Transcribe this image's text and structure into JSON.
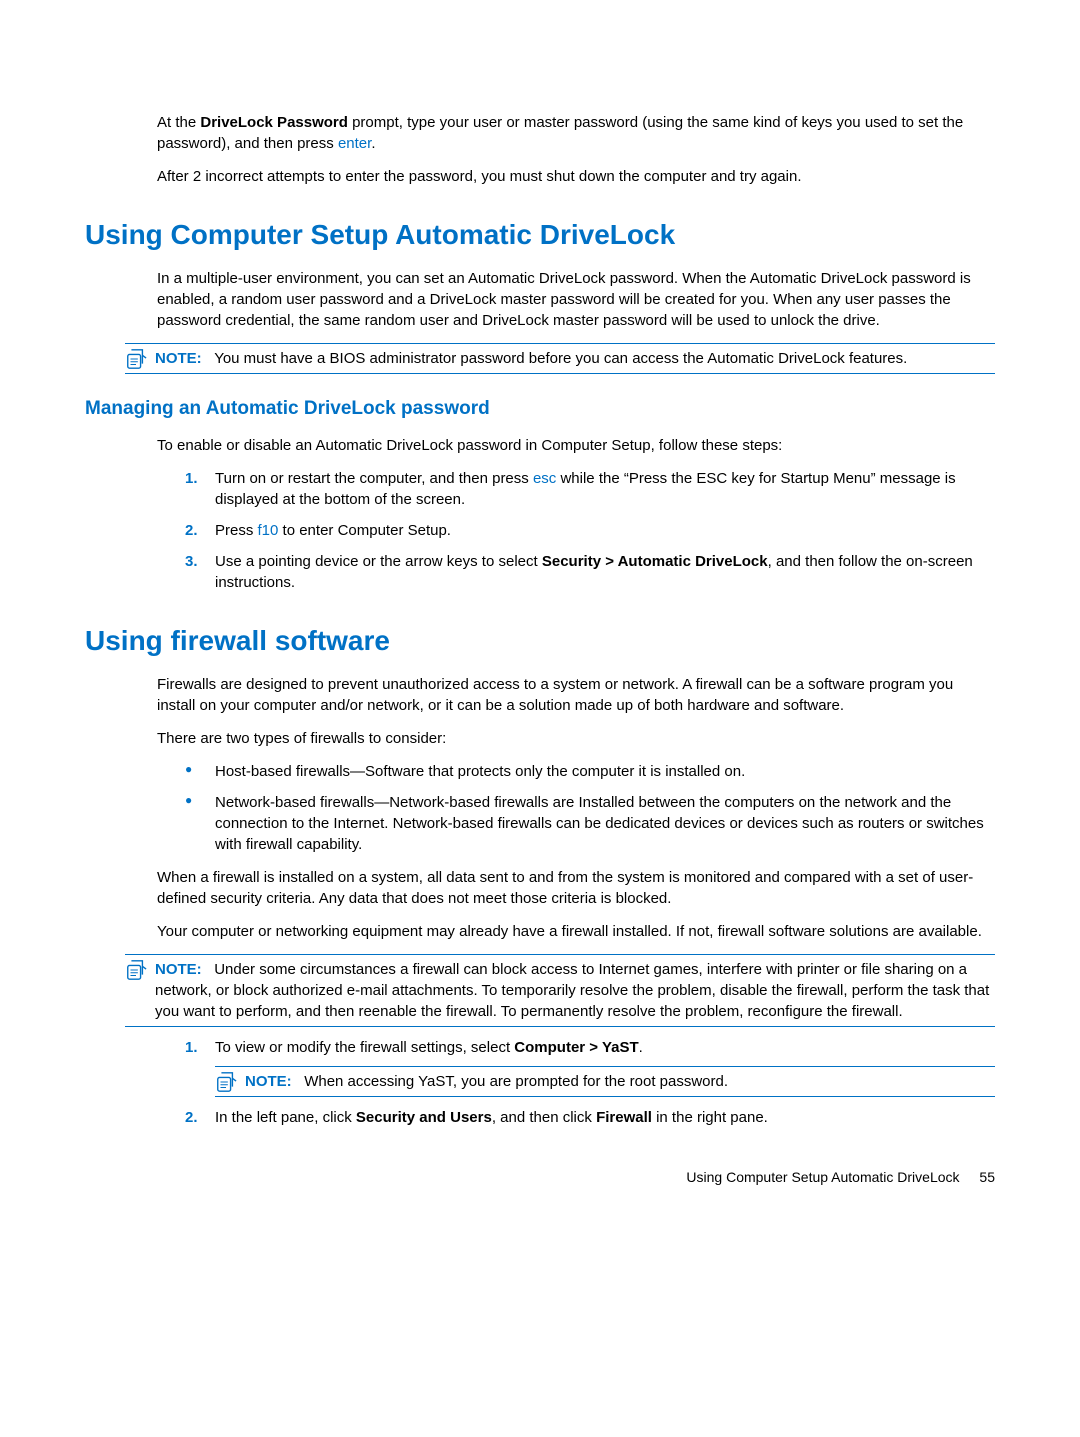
{
  "intro": {
    "p1_a": "At the ",
    "p1_b": "DriveLock Password",
    "p1_c": " prompt, type your user or master password (using the same kind of keys you used to set the password), and then press ",
    "p1_key": "enter",
    "p1_d": ".",
    "p2": "After 2 incorrect attempts to enter the password, you must shut down the computer and try again."
  },
  "sec1": {
    "title": "Using Computer Setup Automatic DriveLock",
    "p1": "In a multiple-user environment, you can set an Automatic DriveLock password. When the Automatic DriveLock password is enabled, a random user password and a DriveLock master password will be created for you. When any user passes the password credential, the same random user and DriveLock master password will be used to unlock the drive.",
    "note_label": "NOTE:",
    "note_text": "You must have a BIOS administrator password before you can access the Automatic DriveLock features.",
    "sub_title": "Managing an Automatic DriveLock password",
    "sub_p1": "To enable or disable an Automatic DriveLock password in Computer Setup, follow these steps:",
    "step1_n": "1.",
    "step1_a": "Turn on or restart the computer, and then press ",
    "step1_key": "esc",
    "step1_b": " while the “Press the ESC key for Startup Menu” message is displayed at the bottom of the screen.",
    "step2_n": "2.",
    "step2_a": "Press ",
    "step2_key": "f10",
    "step2_b": " to enter Computer Setup.",
    "step3_n": "3.",
    "step3_a": "Use a pointing device or the arrow keys to select ",
    "step3_b": "Security > Automatic DriveLock",
    "step3_c": ", and then follow the on-screen instructions."
  },
  "sec2": {
    "title": "Using firewall software",
    "p1": "Firewalls are designed to prevent unauthorized access to a system or network. A firewall can be a software program you install on your computer and/or network, or it can be a solution made up of both hardware and software.",
    "p2": "There are two types of firewalls to consider:",
    "b1": "Host-based firewalls—Software that protects only the computer it is installed on.",
    "b2": "Network-based firewalls—Network-based firewalls are Installed between the computers on the network and the connection to the Internet. Network-based firewalls can be dedicated devices or devices such as routers or switches with firewall capability.",
    "p3": "When a firewall is installed on a system, all data sent to and from the system is monitored and compared with a set of user-defined security criteria. Any data that does not meet those criteria is blocked.",
    "p4": "Your computer or networking equipment may already have a firewall installed. If not, firewall software solutions are available.",
    "note1_label": "NOTE:",
    "note1_text": "Under some circumstances a firewall can block access to Internet games, interfere with printer or file sharing on a network, or block authorized e-mail attachments. To temporarily resolve the problem, disable the firewall, perform the task that you want to perform, and then reenable the firewall. To permanently resolve the problem, reconfigure the firewall.",
    "step1_n": "1.",
    "step1_a": "To view or modify the firewall settings, select ",
    "step1_b": "Computer > YaST",
    "step1_c": ".",
    "note2_label": "NOTE:",
    "note2_text": "When accessing YaST, you are prompted for the root password.",
    "step2_n": "2.",
    "step2_a": "In the left pane, click ",
    "step2_b": "Security and Users",
    "step2_c": ", and then click ",
    "step2_d": "Firewall",
    "step2_e": " in the right pane."
  },
  "footer": {
    "text": "Using Computer Setup Automatic DriveLock",
    "page": "55"
  }
}
